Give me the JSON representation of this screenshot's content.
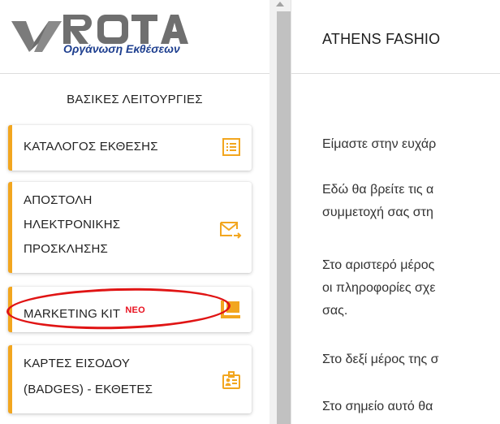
{
  "logo": {
    "brand": "ROTA",
    "tagline": "Οργάνωση Εκθέσεων"
  },
  "sidebar": {
    "section_title": "ΒΑΣΙΚΕΣ ΛΕΙΤΟΥΡΓΙΕΣ",
    "items": [
      {
        "lines": [
          "ΚΑΤΑΛΟΓΟΣ ΕΚΘΕΣΗΣ"
        ],
        "icon": "list-icon"
      },
      {
        "lines": [
          "ΑΠΟΣΤΟΛΗ",
          "ΗΛΕΚΤΡΟΝΙΚΗΣ",
          "ΠΡΟΣΚΛΗΣΗΣ"
        ],
        "icon": "mail-send-icon"
      },
      {
        "lines": [
          "MARKETING KIT"
        ],
        "badge": "NEO",
        "icon": "presentation-icon"
      },
      {
        "lines": [
          "ΚΑΡΤΕΣ ΕΙΣΟΔΟΥ",
          "(BADGES) - ΕΚΘΕΤΕΣ"
        ],
        "icon": "badge-icon"
      }
    ]
  },
  "header": {
    "title": "ATHENS FASHIO"
  },
  "main": {
    "paragraphs": [
      [
        "Είμαστε στην ευχάρ"
      ],
      [
        "Εδώ θα βρείτε τις α",
        "συμμετοχή σας στη"
      ],
      [
        "Στο αριστερό μέρος",
        "οι πληροφορίες σχε",
        "σας."
      ],
      [
        "Στο δεξί μέρος της σ"
      ],
      [
        "Στο σημείο αυτό θα"
      ]
    ]
  },
  "colors": {
    "accent": "#f2a61f",
    "highlight": "#e01414",
    "logo_blue": "#1e3f8f",
    "logo_gray": "#7b7b7b"
  }
}
